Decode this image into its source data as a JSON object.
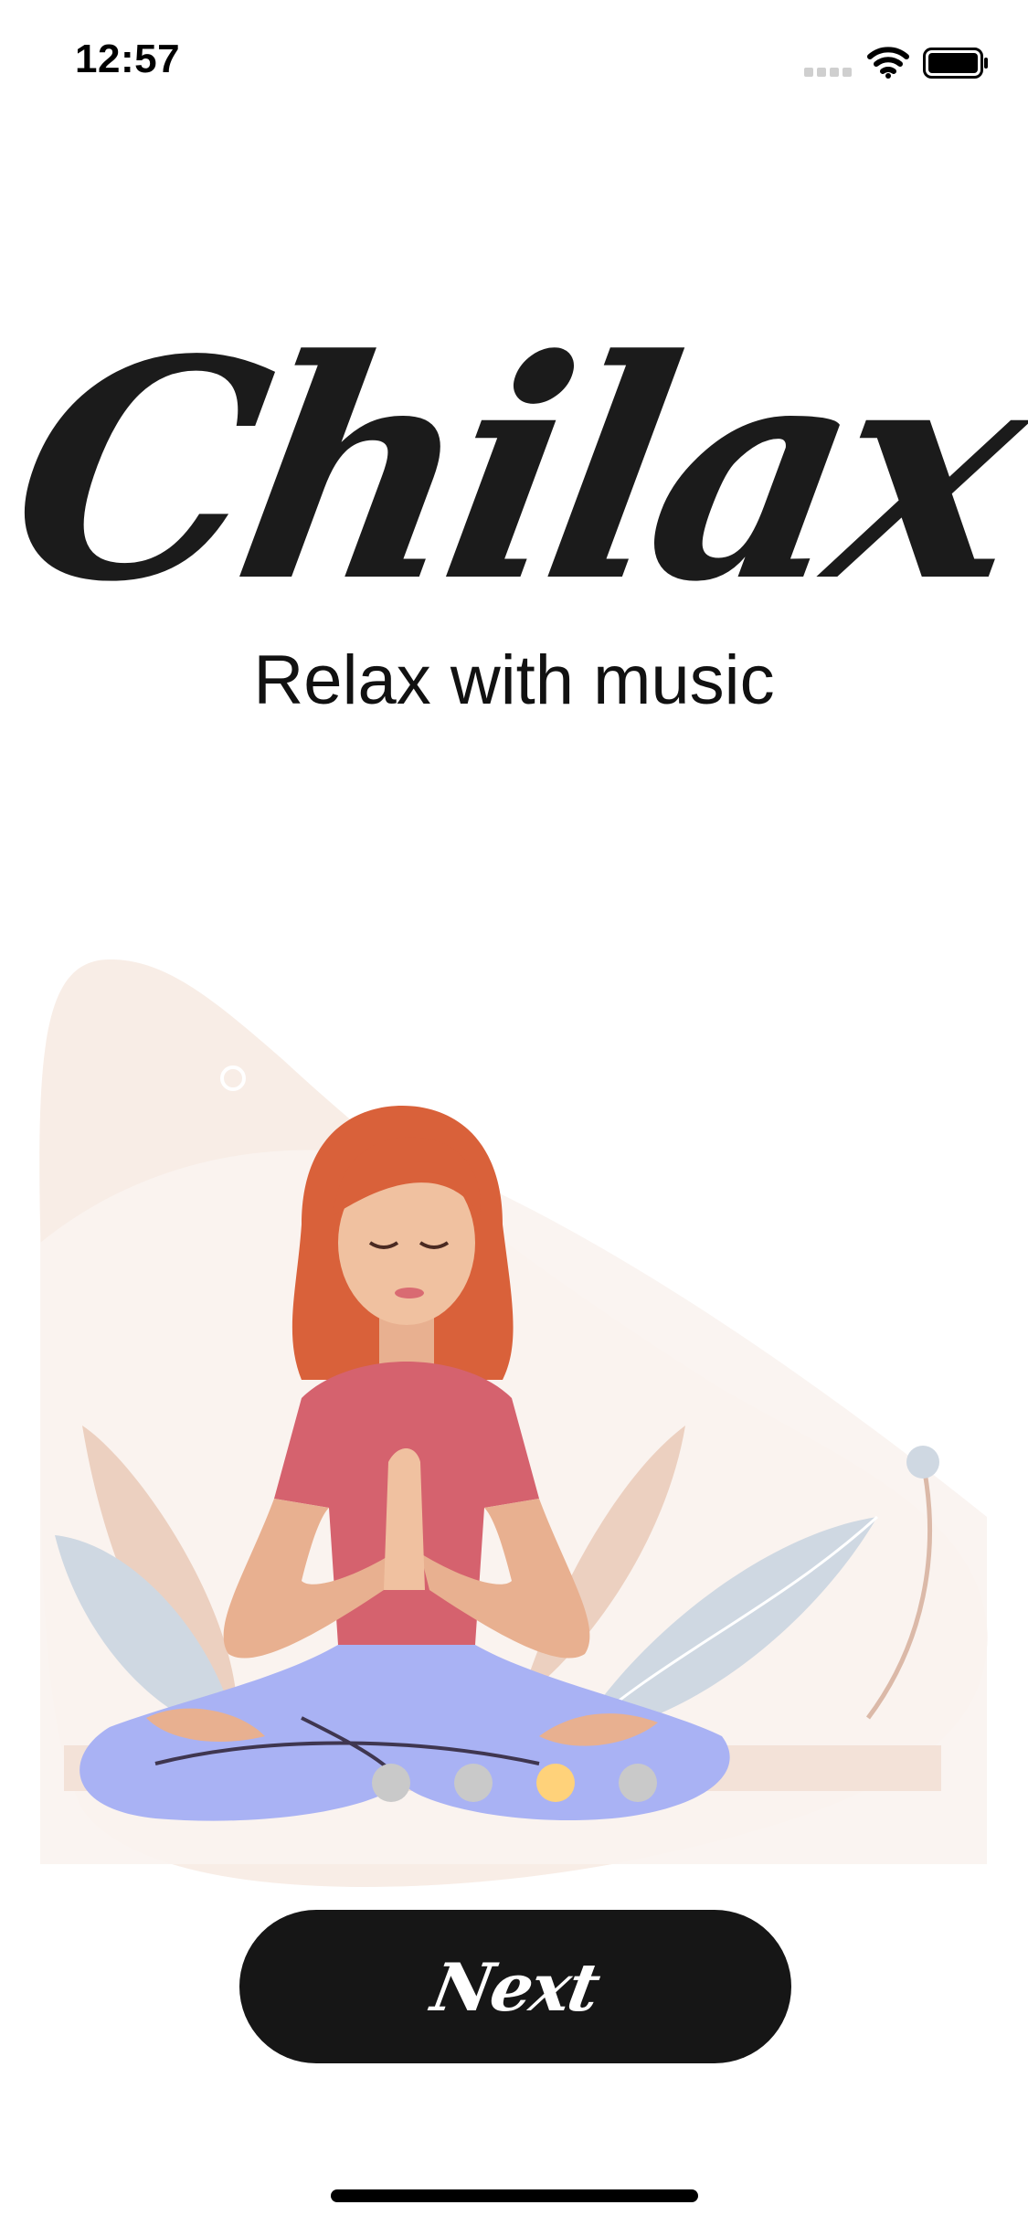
{
  "status_bar": {
    "time": "12:57",
    "icons": [
      "signal-icon",
      "wifi-icon",
      "battery-icon"
    ]
  },
  "brand": {
    "logo_text": "Chilax",
    "tagline": "Relax with music"
  },
  "illustration": {
    "subject": "meditating-woman-icon"
  },
  "pager": {
    "count": 4,
    "active_index": 2
  },
  "next_button": {
    "label": "Next"
  },
  "colors": {
    "accent": "#ffd27a",
    "button": "#161616",
    "dot_inactive": "#c9c9c9",
    "shirt": "#d5626e",
    "pants": "#a9b2f4",
    "hair": "#d9613a",
    "skin": "#e8b090",
    "background_blob": "#f8ede6"
  }
}
